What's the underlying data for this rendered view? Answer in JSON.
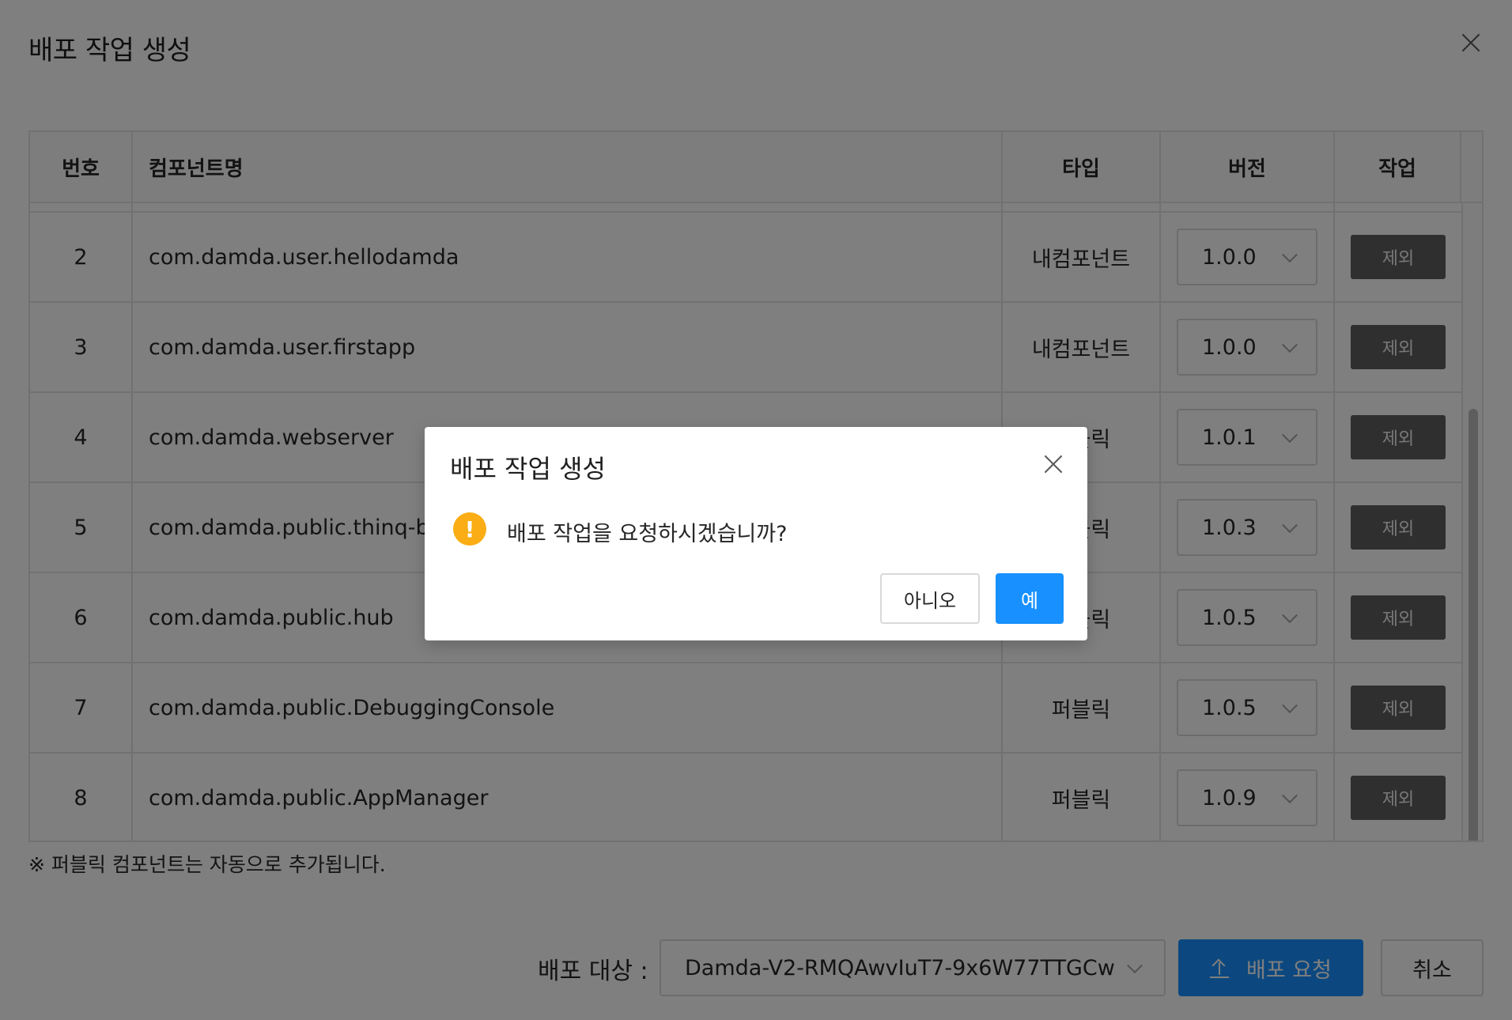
{
  "modal": {
    "title": "배포 작업 생성"
  },
  "table": {
    "headers": {
      "no": "번호",
      "name": "컴포넌트명",
      "type": "타입",
      "version": "버전",
      "action": "작업"
    },
    "rows": [
      {
        "no": "2",
        "name": "com.damda.user.hellodamda",
        "type": "내컴포넌트",
        "version": "1.0.0",
        "action": "제외"
      },
      {
        "no": "3",
        "name": "com.damda.user.firstapp",
        "type": "내컴포넌트",
        "version": "1.0.0",
        "action": "제외"
      },
      {
        "no": "4",
        "name": "com.damda.webserver",
        "type": "퍼블릭",
        "version": "1.0.1",
        "action": "제외"
      },
      {
        "no": "5",
        "name": "com.damda.public.thinq-bash",
        "type": "퍼블릭",
        "version": "1.0.3",
        "action": "제외"
      },
      {
        "no": "6",
        "name": "com.damda.public.hub",
        "type": "퍼블릭",
        "version": "1.0.5",
        "action": "제외"
      },
      {
        "no": "7",
        "name": "com.damda.public.DebuggingConsole",
        "type": "퍼블릭",
        "version": "1.0.5",
        "action": "제외"
      },
      {
        "no": "8",
        "name": "com.damda.public.AppManager",
        "type": "퍼블릭",
        "version": "1.0.9",
        "action": "제외"
      }
    ]
  },
  "footnote": "※ 퍼블릭 컴포넌트는 자동으로 추가됩니다.",
  "footer": {
    "target_label": "배포 대상 :",
    "target_value": "Damda-V2-RMQAwvIuT7-9x6W77TTGCw",
    "deploy_label": "배포 요청",
    "cancel_label": "취소"
  },
  "confirm": {
    "title": "배포 작업 생성",
    "message": "배포 작업을 요청하시겠습니까?",
    "icon": "!",
    "no_label": "아니오",
    "yes_label": "예"
  },
  "colors": {
    "primary": "#1890ff",
    "warning": "#faad14",
    "exclude_button": "#5f5f5f"
  }
}
